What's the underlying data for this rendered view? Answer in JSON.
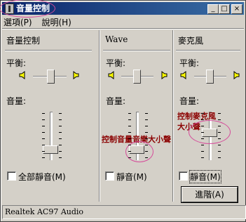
{
  "window": {
    "title": "音量控制"
  },
  "title_buttons": {
    "minimize": "_",
    "maximize": "□",
    "close": "×"
  },
  "menu": [
    "選項(P)",
    "說明(H)"
  ],
  "columns": [
    {
      "title": "音量控制",
      "balance_label": "平衡:",
      "volume_label": "音量:",
      "mute_label": "全部靜音(M)",
      "volume_level": 0.2,
      "balance_level": 0.5
    },
    {
      "title": "Wave",
      "balance_label": "平衡:",
      "volume_label": "音量:",
      "mute_label": "靜音(M)",
      "volume_level": 0.2,
      "balance_level": 0.5
    },
    {
      "title": "麥克風",
      "balance_label": "平衡:",
      "volume_label": "音量:",
      "mute_label": "靜音(M)",
      "volume_level": 0.5,
      "balance_level": 0.5,
      "advanced_label": "進階(A)"
    }
  ],
  "annotations": {
    "wave_note": "控制音量音樂大小聲",
    "mic_note_line1": "控制麥克風",
    "mic_note_line2": "大小聲"
  },
  "status_bar": "Realtek AC97 Audio",
  "colors": {
    "titlebar": "#0a246a",
    "annotation_text": "#8b0000",
    "annotation_ellipse": "#d64b9a"
  }
}
